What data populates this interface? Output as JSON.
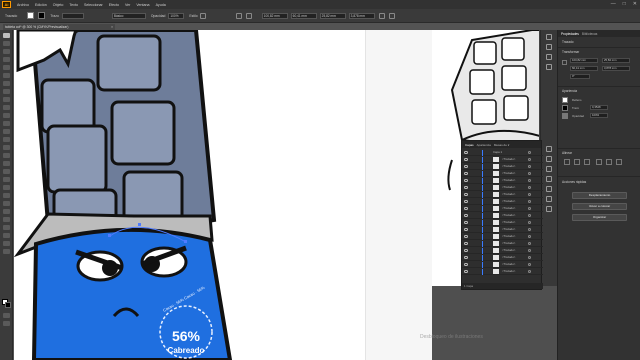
{
  "app": {
    "icon_label": "Ai"
  },
  "menu": {
    "items": [
      "Archivo",
      "Edición",
      "Objeto",
      "Texto",
      "Seleccionar",
      "Efecto",
      "Ver",
      "Ventana",
      "Ayuda"
    ]
  },
  "window": {
    "minimize": "—",
    "maximize": "□",
    "close": "✕"
  },
  "controlbar": {
    "selection_label": "Trazado",
    "stroke_weight_label": "Trazo",
    "brush_label": "Básico",
    "opacity_label": "Opacidad",
    "opacity_value": "100%",
    "style_label": "Estilo",
    "x_value": "100,82 mm",
    "y_value": "60,41 mm",
    "w_value": "25,82 mm",
    "h_value": "3,878 mm"
  },
  "document": {
    "tab_title": "tableta cof* @ 300 % (CMYK/Previsualizar)",
    "close_glyph": "×"
  },
  "canvas": {
    "badge_line1": "56%",
    "badge_line2": "Cabreado",
    "badge_ring_text": "Cacao · 56% Cacao · 56%",
    "watermark": "Desbloqueo de ilustraciones"
  },
  "layers_panel": {
    "tabs": [
      "Capas",
      "Apariencia",
      "Mesas de tr"
    ],
    "top_layer": "Capa 1",
    "row_label": "<Trazado>",
    "footer": "1 Capa"
  },
  "properties_panel": {
    "tabs": [
      "Propiedades",
      "Bibliotecas"
    ],
    "object_type": "Trazado",
    "transform_title": "Transformar",
    "x_field": "100,82 mm",
    "y_field": "60,41 mm",
    "w_field": "25,82 mm",
    "h_field": "3,878 mm",
    "angle_field": "0°",
    "appearance_title": "Apariencia",
    "fill_label": "Relleno",
    "stroke_label": "Trazo",
    "stroke_value": "0,3528",
    "opacity_label": "Opacidad",
    "opacity_value": "100%",
    "align_title": "Alinear",
    "quick_actions_title": "Acciones rápidas",
    "btn_offset": "Desplazamiento",
    "btn_simplify": "Volver a colocar",
    "btn_arrange": "Organizar"
  },
  "colors": {
    "chocolate_wrapper": "#6e7d9a",
    "blue_bar": "#1f6fe0",
    "app_bg": "#535353"
  }
}
